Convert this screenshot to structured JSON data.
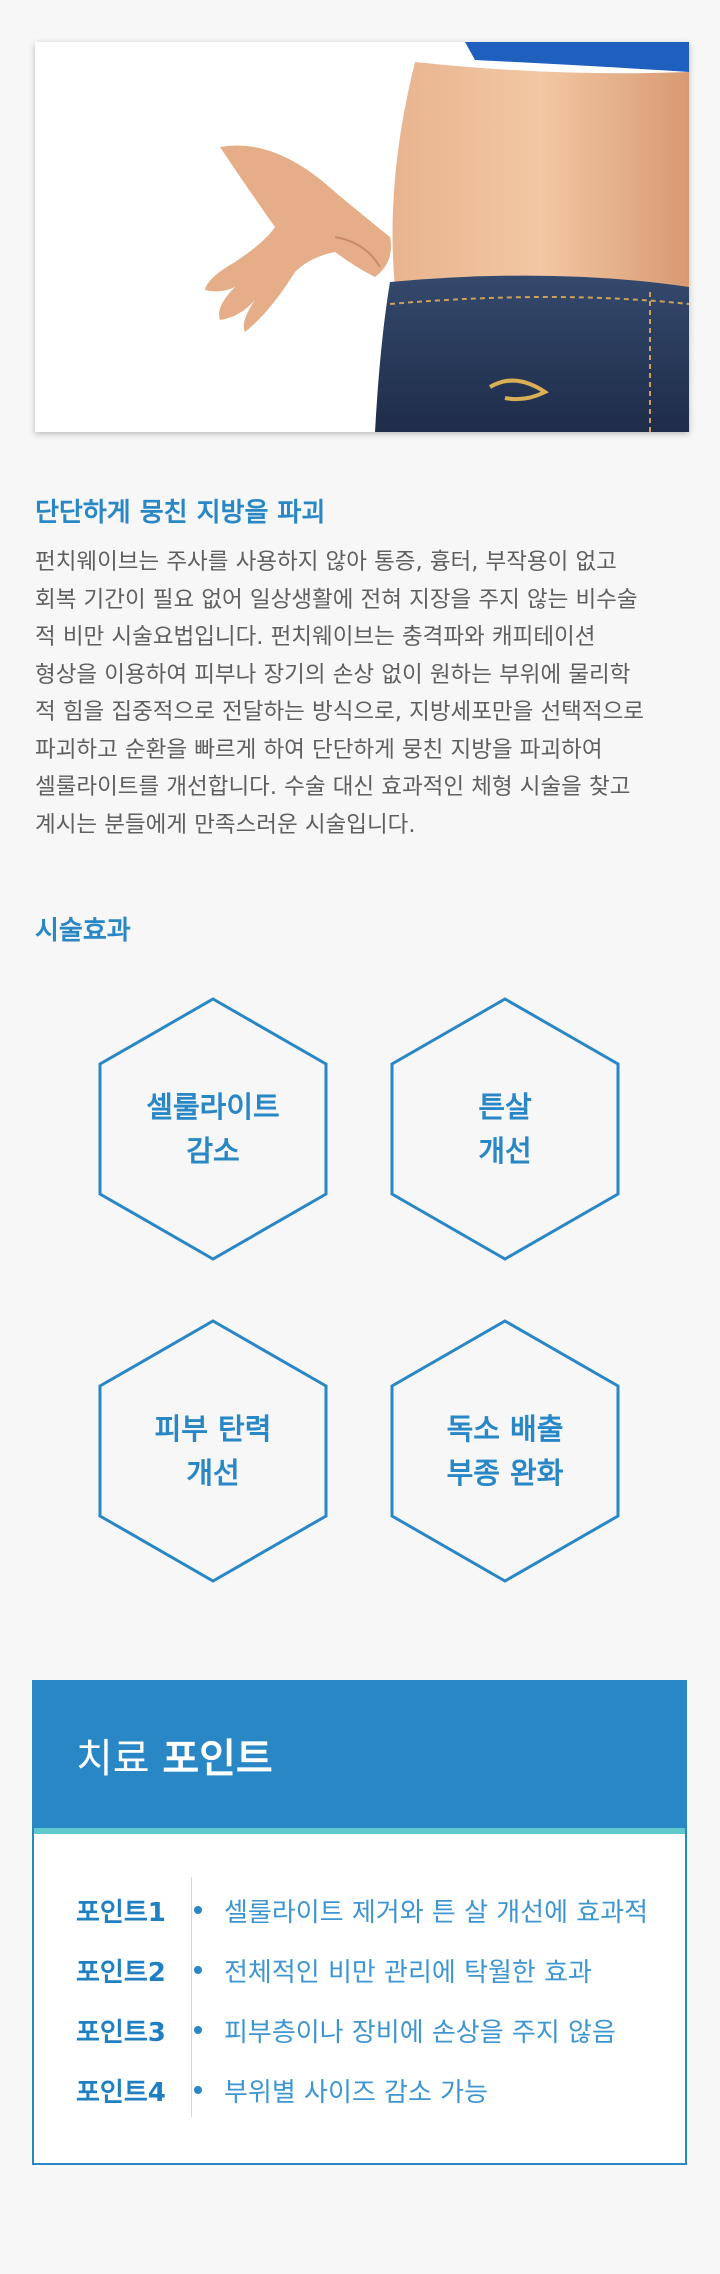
{
  "hero": {
    "image": "waist-pinch-photo"
  },
  "section": {
    "title": "단단하게 뭉친 지방을 파괴",
    "description_lines": [
      "펀치웨이브는 주사를 사용하지 않아 통증, 흉터, 부작용이 없고",
      "회복 기간이 필요 없어 일상생활에 전혀 지장을 주지 않는 비수술",
      "적 비만 시술요법입니다. 펀치웨이브는 충격파와 캐피테이션",
      "형상을 이용하여 피부나 장기의 손상 없이 원하는 부위에 물리학",
      "적 힘을 집중적으로 전달하는 방식으로, 지방세포만을 선택적으로",
      "파괴하고 순환을 빠르게 하여 단단하게 뭉친 지방을 파괴하여",
      "셀룰라이트를 개선합니다.  수술 대신 효과적인 체형 시술을 찾고",
      "계시는 분들에게 만족스러운 시술입니다."
    ]
  },
  "effects": {
    "title": "시술효과",
    "items": [
      {
        "line1": "셀룰라이트",
        "line2": "감소"
      },
      {
        "line1": "튼살",
        "line2": "개선"
      },
      {
        "line1": "피부 탄력",
        "line2": "개선"
      },
      {
        "line1": "독소 배출",
        "line2": "부종 완화"
      }
    ]
  },
  "points": {
    "title_light": "치료",
    "title_bold": "포인트",
    "items": [
      {
        "label": "포인트1",
        "text": "셀룰라이트 제거와 튼 살 개선에 효과적"
      },
      {
        "label": "포인트2",
        "text": "전체적인 비만 관리에 탁월한 효과"
      },
      {
        "label": "포인트3",
        "text": "피부층이나 장비에 손상을 주지 않음"
      },
      {
        "label": "포인트4",
        "text": "부위별 사이즈 감소 가능"
      }
    ]
  },
  "colors": {
    "accent": "#2a87c6",
    "accent_line": "#5ec8cc",
    "background": "#f7f7f7"
  }
}
